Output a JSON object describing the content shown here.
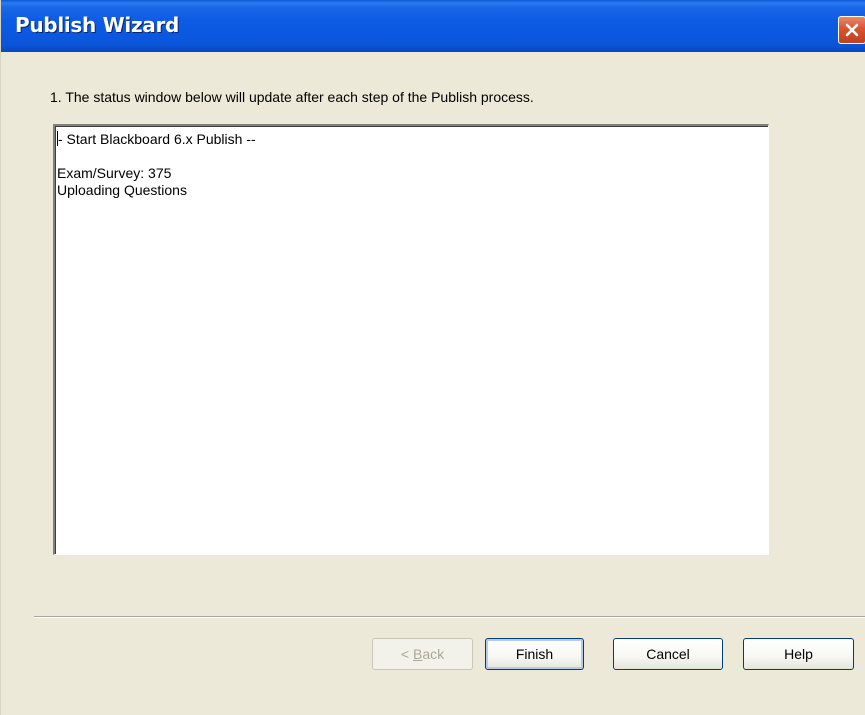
{
  "window": {
    "title": "Publish Wizard"
  },
  "instructions": {
    "step_text": "1.  The status window below will update after each step of the Publish process."
  },
  "status_window": {
    "lines": [
      "- Start Blackboard 6.x Publish --",
      "",
      "Exam/Survey: 375",
      "Uploading Questions"
    ]
  },
  "buttons": {
    "back_prefix": "< ",
    "back_mnemonic": "B",
    "back_rest": "ack",
    "finish": "Finish",
    "cancel": "Cancel",
    "help": "Help"
  },
  "colors": {
    "titlebar": "#0b58e0",
    "dialog_bg": "#ece9d8",
    "close_button": "#d8532f"
  },
  "icons": {
    "close": "close-icon"
  }
}
